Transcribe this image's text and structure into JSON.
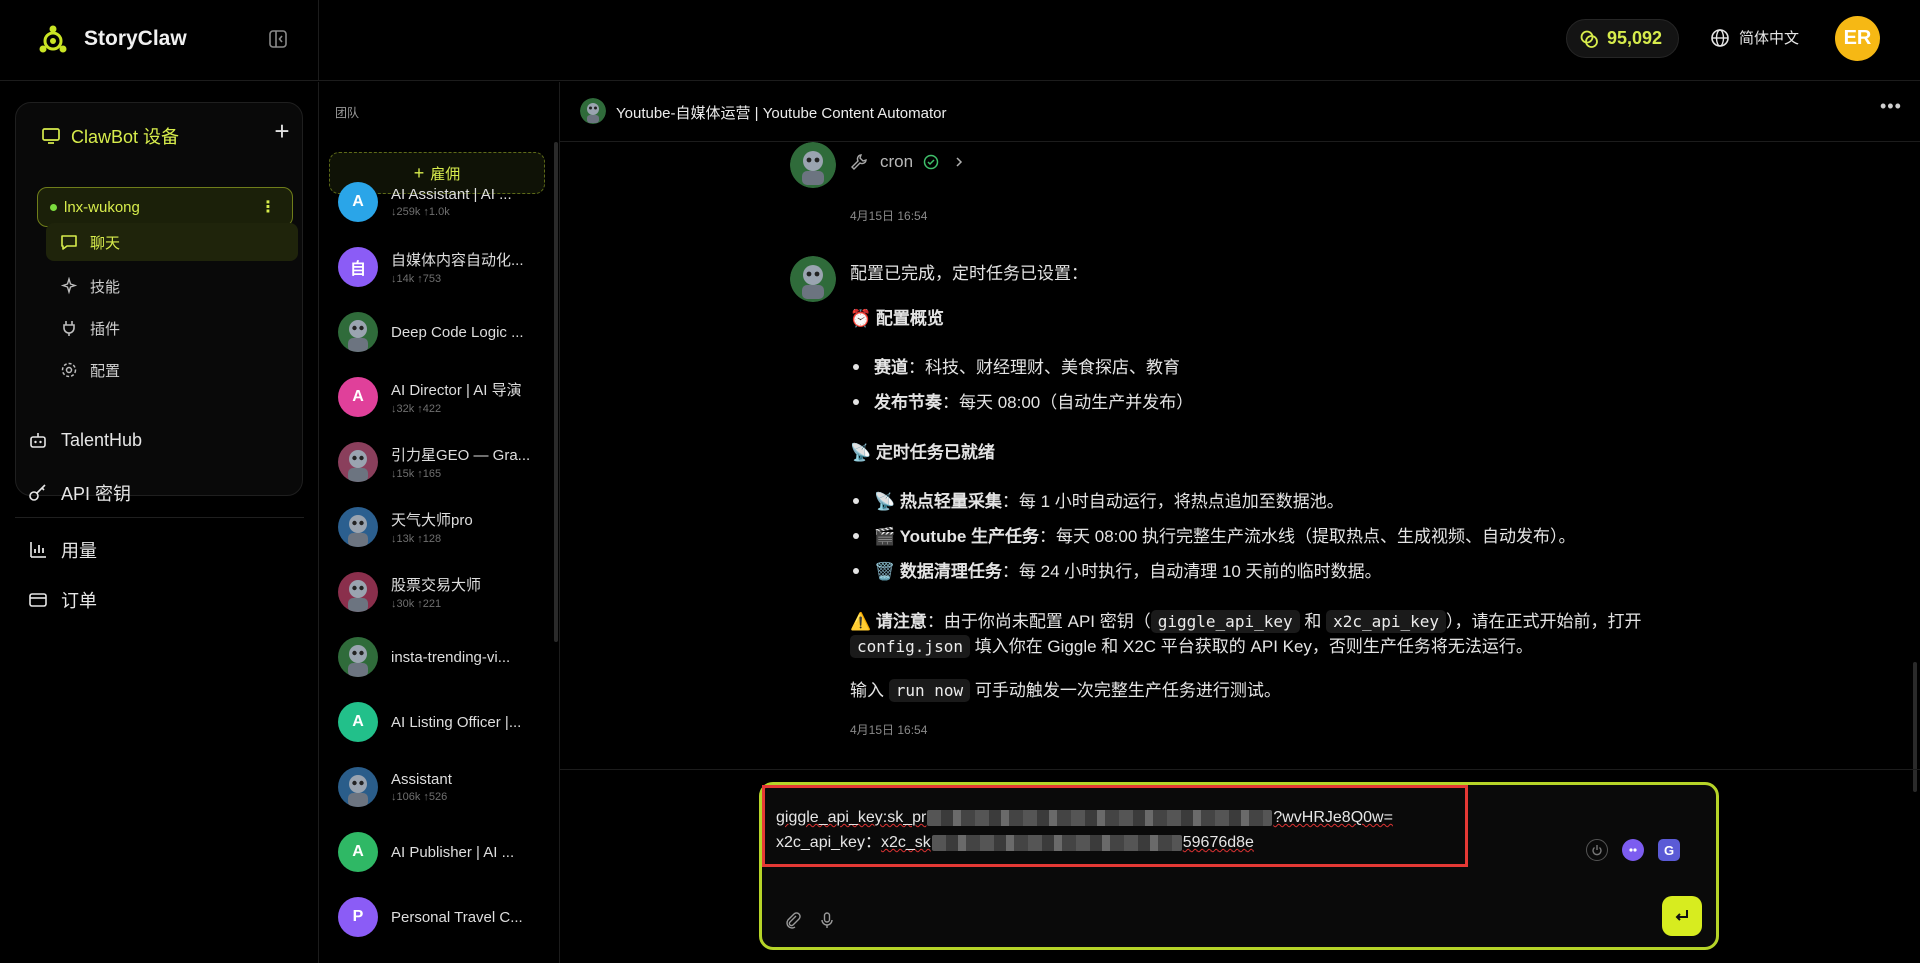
{
  "app": {
    "brand_name": "StoryClaw",
    "credits": "95,092",
    "language": "简体中文",
    "user_initials": "ER",
    "accent_color": "#d7ec4c"
  },
  "sidebar": {
    "devices_title": "ClawBot 设备",
    "device_name": "lnx-wukong",
    "nav": [
      {
        "label": "聊天",
        "icon": "chat-icon",
        "active": true
      },
      {
        "label": "技能",
        "icon": "sparkles-icon",
        "active": false
      },
      {
        "label": "插件",
        "icon": "plug-icon",
        "active": false
      },
      {
        "label": "配置",
        "icon": "gear-icon",
        "active": false
      }
    ],
    "menu": [
      {
        "label": "TalentHub",
        "icon": "robot-icon"
      },
      {
        "label": "API 密钥",
        "icon": "key-icon"
      },
      {
        "label": "用量",
        "icon": "bar-chart-icon"
      },
      {
        "label": "订单",
        "icon": "card-icon"
      }
    ]
  },
  "team": {
    "label": "团队",
    "hire_label": "雇佣",
    "members": [
      {
        "name": "AI Assistant | AI ...",
        "stats": "↓259k ↑1.0k",
        "initial": "A",
        "color": "#2aa5e8"
      },
      {
        "name": "自媒体内容自动化...",
        "stats": "↓14k ↑753",
        "initial": "自",
        "color": "#8b5cf6"
      },
      {
        "name": "Deep Code Logic ...",
        "stats": "",
        "initial": "",
        "color": "#2f6b3a"
      },
      {
        "name": "AI Director | AI 导演",
        "stats": "↓32k ↑422",
        "initial": "A",
        "color": "#e0409a"
      },
      {
        "name": "引力星GEO — Gra...",
        "stats": "↓15k ↑165",
        "initial": "",
        "color": "#8a3f5c"
      },
      {
        "name": "天气大师pro",
        "stats": "↓13k ↑128",
        "initial": "",
        "color": "#2b5f8f"
      },
      {
        "name": "股票交易大师",
        "stats": "↓30k ↑221",
        "initial": "",
        "color": "#8a2f4c"
      },
      {
        "name": "insta-trending-vi...",
        "stats": "",
        "initial": "",
        "color": "#2f6b3a"
      },
      {
        "name": "AI Listing Officer |...",
        "stats": "",
        "initial": "A",
        "color": "#22c08a"
      },
      {
        "name": "Assistant",
        "stats": "↓106k ↑526",
        "initial": "",
        "color": "#2a5d8a"
      },
      {
        "name": "AI Publisher | AI ...",
        "stats": "",
        "initial": "A",
        "color": "#2fb865"
      },
      {
        "name": "Personal Travel C...",
        "stats": "",
        "initial": "P",
        "color": "#8b5cf6"
      }
    ]
  },
  "chat": {
    "title": "Youtube-自媒体运营 | Youtube Content Automator",
    "tool_name": "cron",
    "timestamp_1": "4月15日 16:54",
    "timestamp_2": "4月15日 16:54",
    "message": {
      "intro": "配置已完成，定时任务已设置：",
      "section1_title": "⏰ 配置概览",
      "s1_b1_label": "赛道",
      "s1_b1_text": "：科技、财经理财、美食探店、教育",
      "s1_b2_label": "发布节奏",
      "s1_b2_text": "：每天 08:00（自动生产并发布）",
      "section2_title": "📡 定时任务已就绪",
      "s2_b1_label": "📡 热点轻量采集",
      "s2_b1_text": "：每 1 小时自动运行，将热点追加至数据池。",
      "s2_b2_label": "🎬 Youtube 生产任务",
      "s2_b2_text": "：每天 08:00 执行完整生产流水线（提取热点、生成视频、自动发布）。",
      "s2_b3_label": "🗑️ 数据清理任务",
      "s2_b3_text": "：每 24 小时执行，自动清理 10 天前的临时数据。",
      "warn_label": "⚠️ 请注意",
      "warn_text_a": "：由于你尚未配置 API 密钥（",
      "warn_code1": "giggle_api_key",
      "warn_and": " 和 ",
      "warn_code2": "x2c_api_key",
      "warn_text_b": "），请在正式开始前，打开",
      "warn_code3": "config.json",
      "warn_text_c": " 填入你在 Giggle 和 X2C 平台获取的 API Key，否则生产任务将无法运行。",
      "run_a": "输入 ",
      "run_code": "run now",
      "run_b": " 可手动触发一次完整生产任务进行测试。"
    }
  },
  "composer": {
    "line1_prefix": "giggle_api_key:sk_pr",
    "line1_suffix": "?wvHRJe8Q0w=",
    "line2_prefix": "x2c_api_key：",
    "line2_key_start": "x2c_sk",
    "line2_suffix": "59676d8e"
  }
}
